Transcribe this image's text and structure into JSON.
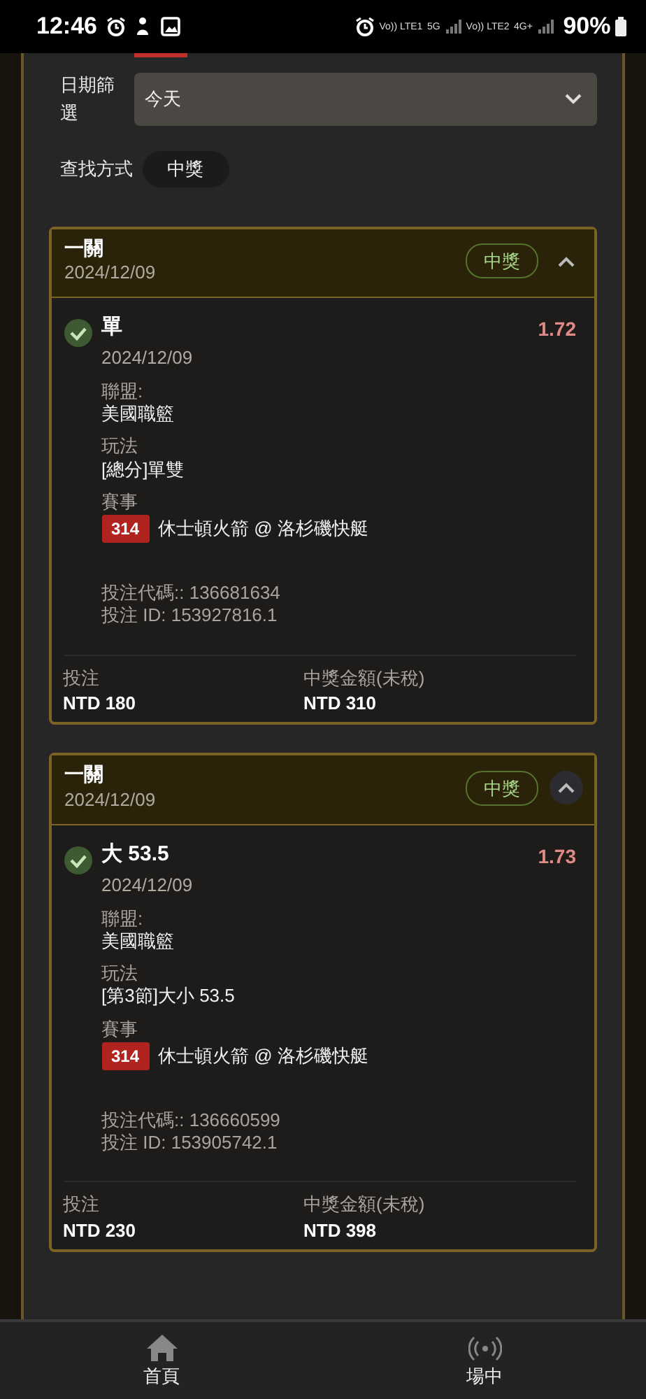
{
  "status_bar": {
    "time": "12:46",
    "net_labels": [
      "Vo)) LTE1",
      "5G",
      "Vo)) LTE2",
      "4G+"
    ],
    "battery": "90%"
  },
  "filter": {
    "label": "日期篩選",
    "value": "今天",
    "search_label": "查找方式",
    "search_value": "中獎"
  },
  "cards": [
    {
      "title": "一關",
      "date": "2024/12/09",
      "status": "中獎",
      "expanded": true,
      "toggle_focused": false,
      "won": true,
      "selection": "單",
      "bet_date": "2024/12/09",
      "odds": "1.72",
      "fields": [
        {
          "label": "聯盟:",
          "value": "美國職籃"
        },
        {
          "label": "玩法",
          "value": "[總分]單雙"
        }
      ],
      "event_label": "賽事",
      "event_code": "314",
      "event_name": "休士頓火箭 @ 洛杉磯快艇",
      "bet_code": "投注代碼:: 136681634",
      "bet_id": "投注 ID: 153927816.1",
      "stake_label": "投注",
      "stake": "NTD 180",
      "payout_label": "中獎金額(未稅)",
      "payout": "NTD 310"
    },
    {
      "title": "一關",
      "date": "2024/12/09",
      "status": "中獎",
      "expanded": true,
      "toggle_focused": true,
      "won": true,
      "selection": "大 53.5",
      "bet_date": "2024/12/09",
      "odds": "1.73",
      "fields": [
        {
          "label": "聯盟:",
          "value": "美國職籃"
        },
        {
          "label": "玩法",
          "value": "[第3節]大小 53.5"
        }
      ],
      "event_label": "賽事",
      "event_code": "314",
      "event_name": "休士頓火箭 @ 洛杉磯快艇",
      "bet_code": "投注代碼:: 136660599",
      "bet_id": "投注 ID: 153905742.1",
      "stake_label": "投注",
      "stake": "NTD 230",
      "payout_label": "中獎金額(未稅)",
      "payout": "NTD 398"
    }
  ],
  "bottom_nav": [
    {
      "kind": "home",
      "label": "首頁"
    },
    {
      "kind": "live",
      "label": "場中"
    }
  ]
}
